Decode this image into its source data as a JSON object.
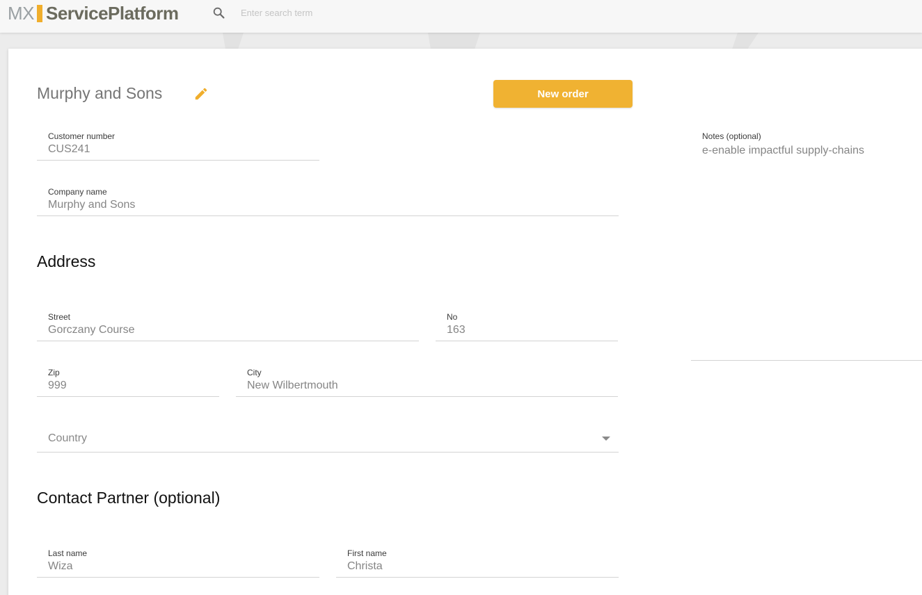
{
  "header": {
    "logo_mx": "MX",
    "logo_name": "ServicePlatform",
    "search_placeholder": "Enter search term"
  },
  "customer": {
    "title": "Murphy and Sons",
    "new_order_label": "New order"
  },
  "fields": {
    "customer_number": {
      "label": "Customer number",
      "value": "CUS241"
    },
    "company_name": {
      "label": "Company name",
      "value": "Murphy and Sons"
    },
    "notes": {
      "label": "Notes (optional)",
      "value": "e-enable impactful supply-chains"
    }
  },
  "address": {
    "heading": "Address",
    "street": {
      "label": "Street",
      "value": "Gorczany Course"
    },
    "no": {
      "label": "No",
      "value": "163"
    },
    "zip": {
      "label": "Zip",
      "value": "999"
    },
    "city": {
      "label": "City",
      "value": "New Wilbertmouth"
    },
    "country": {
      "placeholder": "Country"
    }
  },
  "contact": {
    "heading": "Contact Partner (optional)",
    "last_name": {
      "label": "Last name",
      "value": "Wiza"
    },
    "first_name": {
      "label": "First name",
      "value": "Christa"
    }
  },
  "colors": {
    "accent": "#f0b232",
    "logo_bar": "#f0ae2c",
    "text_muted": "#858585"
  },
  "icons": {
    "search": "search-icon",
    "edit": "pencil-icon",
    "dropdown": "chevron-down-icon"
  }
}
